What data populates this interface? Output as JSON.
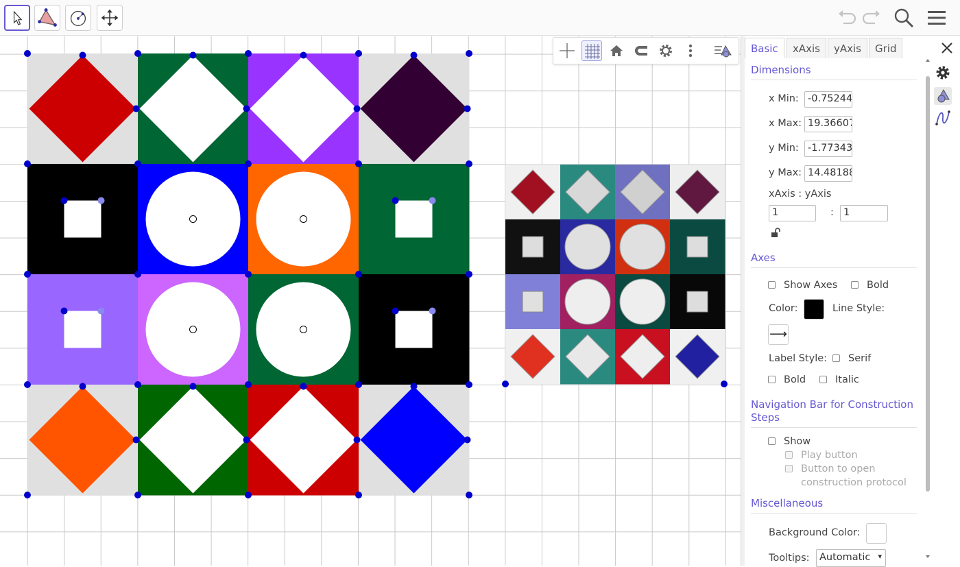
{
  "toolbar": {
    "tools": [
      {
        "name": "move-tool",
        "icon": "pointer-icon"
      },
      {
        "name": "polygon-tool",
        "icon": "polygon-icon"
      },
      {
        "name": "circle-tool",
        "icon": "circle-icon"
      },
      {
        "name": "move-graphics-tool",
        "icon": "move-arrows-icon"
      }
    ],
    "right_icons": [
      "undo-icon",
      "redo-icon",
      "search-icon",
      "menu-icon"
    ]
  },
  "stylebar": {
    "buttons": [
      "axes-toggle-icon",
      "grid-toggle-icon",
      "home-icon",
      "magnet-icon",
      "gear-icon",
      "more-icon",
      "panel-toggle-icon"
    ]
  },
  "colors": {
    "accent": "#6557d2",
    "tile_gray": "#e0e0e0",
    "red": "#cc0000",
    "dark_green": "#006633",
    "green": "#006600",
    "purple": "#9933ff",
    "dark_purple": "#330033",
    "black": "#000000",
    "blue": "#0000ff",
    "orange": "#ff6600",
    "light_purple": "#9966ff",
    "lilac": "#cc66ff",
    "orange_red": "#ff5500",
    "point_blue": "#0000cc"
  },
  "panel": {
    "tabs": [
      "Basic",
      "xAxis",
      "yAxis",
      "Grid"
    ],
    "active_tab": "Basic",
    "dimensions": {
      "title": "Dimensions",
      "xmin_label": "x Min:",
      "xmin": "-0.75244",
      "xmax_label": "x Max:",
      "xmax": "19.36607",
      "ymin_label": "y Min:",
      "ymin": "-1.77343",
      "ymax_label": "y Max:",
      "ymax": "14.48188",
      "ratio_label": "xAxis : yAxis",
      "ratio_x": "1",
      "ratio_sep": ":",
      "ratio_y": "1"
    },
    "axes": {
      "title": "Axes",
      "show_axes": "Show Axes",
      "bold": "Bold",
      "color_label": "Color:",
      "color_value": "#000000",
      "line_style_label": "Line Style:",
      "line_style_arrow": "⟶",
      "label_style_label": "Label Style:",
      "serif": "Serif",
      "bold2": "Bold",
      "italic": "Italic"
    },
    "navigation": {
      "title_line1": "Navigation Bar for Construction",
      "title_line2": "Steps",
      "show": "Show",
      "play_button": "Play button",
      "protocol_line1": "Button to open",
      "protocol_line2": "construction protocol"
    },
    "misc": {
      "title": "Miscellaneous",
      "bg_color_label": "Background Color:",
      "bg_color_value": "#ffffff",
      "tooltips_label": "Tooltips:",
      "tooltips_value": "Automatic"
    }
  }
}
